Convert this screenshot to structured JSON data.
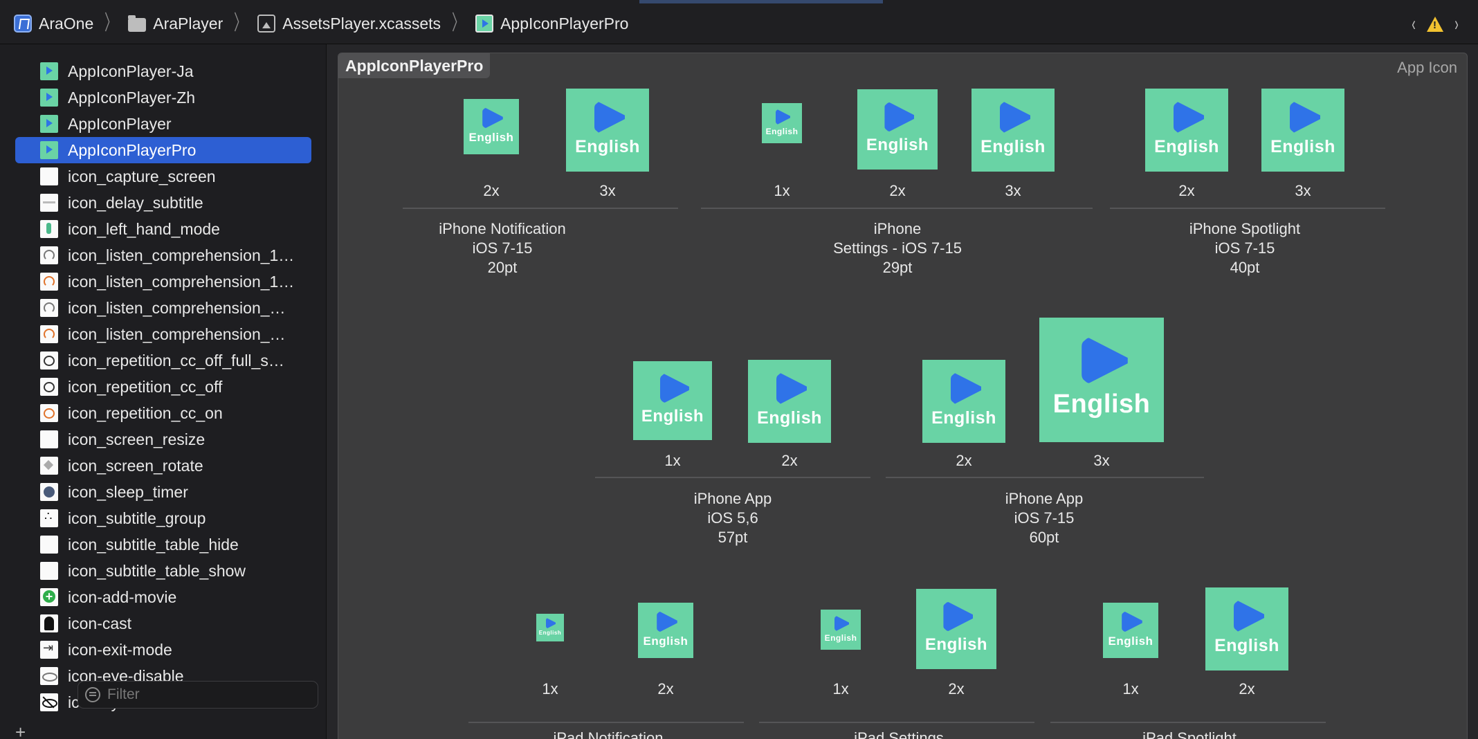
{
  "breadcrumb": [
    {
      "label": "AraOne",
      "icon": "app-project-icon"
    },
    {
      "label": "AraPlayer",
      "icon": "folder-icon"
    },
    {
      "label": "AssetsPlayer.xcassets",
      "icon": "asset-catalog-icon"
    },
    {
      "label": "AppIconPlayerPro",
      "icon": "app-icon-set-icon"
    }
  ],
  "nav": {
    "back": "‹",
    "forward": "›",
    "warning_icon": "warning-triangle-icon"
  },
  "sidebar": {
    "items": [
      {
        "label": "AppIconPlayer-Ja",
        "thumb": "app"
      },
      {
        "label": "AppIconPlayer-Zh",
        "thumb": "app"
      },
      {
        "label": "AppIconPlayer",
        "thumb": "app"
      },
      {
        "label": "AppIconPlayerPro",
        "thumb": "app",
        "selected": true
      },
      {
        "label": "icon_capture_screen",
        "thumb": "blank"
      },
      {
        "label": "icon_delay_subtitle",
        "thumb": "line"
      },
      {
        "label": "icon_left_hand_mode",
        "thumb": "hand"
      },
      {
        "label": "icon_listen_comprehension_1…",
        "thumb": "head"
      },
      {
        "label": "icon_listen_comprehension_1…",
        "thumb": "head-or"
      },
      {
        "label": "icon_listen_comprehension_…",
        "thumb": "head"
      },
      {
        "label": "icon_listen_comprehension_…",
        "thumb": "head-or"
      },
      {
        "label": "icon_repetition_cc_off_full_s…",
        "thumb": "cc"
      },
      {
        "label": "icon_repetition_cc_off",
        "thumb": "cc"
      },
      {
        "label": "icon_repetition_cc_on",
        "thumb": "cc-or"
      },
      {
        "label": "icon_screen_resize",
        "thumb": "blank"
      },
      {
        "label": "icon_screen_rotate",
        "thumb": "rot"
      },
      {
        "label": "icon_sleep_timer",
        "thumb": "sleep"
      },
      {
        "label": "icon_subtitle_group",
        "thumb": "dots"
      },
      {
        "label": "icon_subtitle_table_hide",
        "thumb": "blank"
      },
      {
        "label": "icon_subtitle_table_show",
        "thumb": "blank"
      },
      {
        "label": "icon-add-movie",
        "thumb": "add"
      },
      {
        "label": "icon-cast",
        "thumb": "person"
      },
      {
        "label": "icon-exit-mode",
        "thumb": "exit"
      },
      {
        "label": "icon-eye-disable",
        "thumb": "eye"
      },
      {
        "label": "icon-eye-invisible",
        "thumb": "eye-x"
      }
    ],
    "add_label": "+",
    "filter_placeholder": "Filter"
  },
  "editor": {
    "set_name": "AppIconPlayerPro",
    "set_type": "App Icon",
    "icon_text": "English",
    "groups": [
      {
        "caption": [
          "iPhone Notification",
          "iOS 7-15",
          "20pt"
        ],
        "slots": [
          "2x",
          "3x"
        ]
      },
      {
        "caption": [
          "iPhone",
          "Settings - iOS 7-15",
          "29pt"
        ],
        "slots": [
          "1x",
          "2x",
          "3x"
        ]
      },
      {
        "caption": [
          "iPhone Spotlight",
          "iOS 7-15",
          "40pt"
        ],
        "slots": [
          "2x",
          "3x"
        ]
      },
      {
        "caption": [
          "iPhone App",
          "iOS 5,6",
          "57pt"
        ],
        "slots": [
          "1x",
          "2x"
        ]
      },
      {
        "caption": [
          "iPhone App",
          "iOS 7-15",
          "60pt"
        ],
        "slots": [
          "2x",
          "3x"
        ]
      },
      {
        "caption": [
          "iPad Notification"
        ],
        "slots": [
          "1x",
          "2x"
        ]
      },
      {
        "caption": [
          "iPad Settings"
        ],
        "slots": [
          "1x",
          "2x"
        ]
      },
      {
        "caption": [
          "iPad Spotlight"
        ],
        "slots": [
          "1x",
          "2x"
        ]
      }
    ]
  },
  "colors": {
    "icon_bg": "#69d3a5",
    "play": "#2f73e8",
    "selection": "#2d5fd3",
    "warning": "#f2c230"
  }
}
